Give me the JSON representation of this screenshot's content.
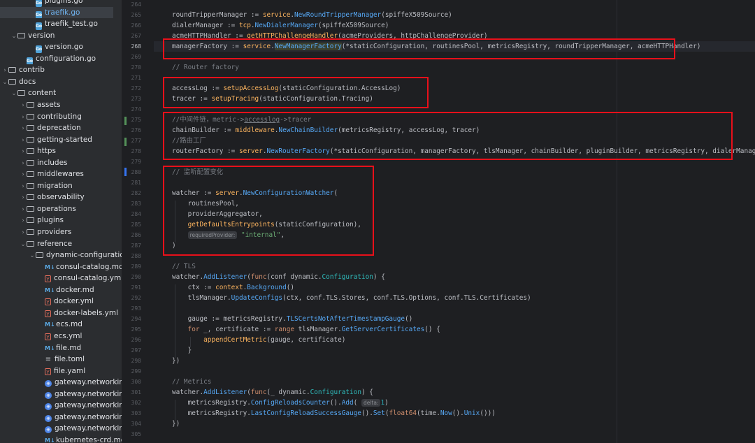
{
  "sidebar": {
    "items": [
      {
        "label": "plugins.go",
        "icon": "go-file-icon",
        "kind": "go",
        "depth": 3,
        "chev": "",
        "selected": false
      },
      {
        "label": "traefik.go",
        "icon": "go-file-icon",
        "kind": "go",
        "depth": 3,
        "chev": "",
        "selected": true
      },
      {
        "label": "traefik_test.go",
        "icon": "go-file-icon",
        "kind": "go",
        "depth": 3,
        "chev": "",
        "selected": false
      },
      {
        "label": "version",
        "icon": "folder-icon",
        "kind": "folder",
        "depth": 1,
        "chev": "⌄",
        "selected": false
      },
      {
        "label": "version.go",
        "icon": "go-file-icon",
        "kind": "go",
        "depth": 3,
        "chev": "",
        "selected": false
      },
      {
        "label": "configuration.go",
        "icon": "go-file-icon",
        "kind": "go",
        "depth": 2,
        "chev": "",
        "selected": false
      },
      {
        "label": "contrib",
        "icon": "folder-icon",
        "kind": "folder",
        "depth": 0,
        "chev": "›",
        "selected": false
      },
      {
        "label": "docs",
        "icon": "folder-icon",
        "kind": "folder",
        "depth": 0,
        "chev": "⌄",
        "selected": false
      },
      {
        "label": "content",
        "icon": "folder-icon",
        "kind": "folder",
        "depth": 1,
        "chev": "⌄",
        "selected": false
      },
      {
        "label": "assets",
        "icon": "folder-icon",
        "kind": "folder",
        "depth": 2,
        "chev": "›",
        "selected": false
      },
      {
        "label": "contributing",
        "icon": "folder-icon",
        "kind": "folder",
        "depth": 2,
        "chev": "›",
        "selected": false
      },
      {
        "label": "deprecation",
        "icon": "folder-icon",
        "kind": "folder",
        "depth": 2,
        "chev": "›",
        "selected": false
      },
      {
        "label": "getting-started",
        "icon": "folder-icon",
        "kind": "folder",
        "depth": 2,
        "chev": "›",
        "selected": false
      },
      {
        "label": "https",
        "icon": "folder-icon",
        "kind": "folder",
        "depth": 2,
        "chev": "›",
        "selected": false
      },
      {
        "label": "includes",
        "icon": "folder-icon",
        "kind": "folder",
        "depth": 2,
        "chev": "›",
        "selected": false
      },
      {
        "label": "middlewares",
        "icon": "folder-icon",
        "kind": "folder",
        "depth": 2,
        "chev": "›",
        "selected": false
      },
      {
        "label": "migration",
        "icon": "folder-icon",
        "kind": "folder",
        "depth": 2,
        "chev": "›",
        "selected": false
      },
      {
        "label": "observability",
        "icon": "folder-icon",
        "kind": "folder",
        "depth": 2,
        "chev": "›",
        "selected": false
      },
      {
        "label": "operations",
        "icon": "folder-icon",
        "kind": "folder",
        "depth": 2,
        "chev": "›",
        "selected": false
      },
      {
        "label": "plugins",
        "icon": "folder-icon",
        "kind": "folder",
        "depth": 2,
        "chev": "›",
        "selected": false
      },
      {
        "label": "providers",
        "icon": "folder-icon",
        "kind": "folder",
        "depth": 2,
        "chev": "›",
        "selected": false
      },
      {
        "label": "reference",
        "icon": "folder-icon",
        "kind": "folder",
        "depth": 2,
        "chev": "⌄",
        "selected": false
      },
      {
        "label": "dynamic-configuration",
        "icon": "folder-icon",
        "kind": "folder",
        "depth": 3,
        "chev": "⌄",
        "selected": false
      },
      {
        "label": "consul-catalog.md",
        "icon": "markdown-icon",
        "kind": "md",
        "depth": 4,
        "chev": "",
        "selected": false
      },
      {
        "label": "consul-catalog.yml",
        "icon": "yaml-icon",
        "kind": "yml",
        "depth": 4,
        "chev": "",
        "selected": false
      },
      {
        "label": "docker.md",
        "icon": "markdown-icon",
        "kind": "md",
        "depth": 4,
        "chev": "",
        "selected": false
      },
      {
        "label": "docker.yml",
        "icon": "yaml-icon",
        "kind": "yml",
        "depth": 4,
        "chev": "",
        "selected": false
      },
      {
        "label": "docker-labels.yml",
        "icon": "yaml-icon",
        "kind": "yml",
        "depth": 4,
        "chev": "",
        "selected": false
      },
      {
        "label": "ecs.md",
        "icon": "markdown-icon",
        "kind": "md",
        "depth": 4,
        "chev": "",
        "selected": false
      },
      {
        "label": "ecs.yml",
        "icon": "yaml-icon",
        "kind": "yml",
        "depth": 4,
        "chev": "",
        "selected": false
      },
      {
        "label": "file.md",
        "icon": "markdown-icon",
        "kind": "md",
        "depth": 4,
        "chev": "",
        "selected": false
      },
      {
        "label": "file.toml",
        "icon": "toml-icon",
        "kind": "toml",
        "depth": 4,
        "chev": "",
        "selected": false
      },
      {
        "label": "file.yaml",
        "icon": "yaml-icon",
        "kind": "yml",
        "depth": 4,
        "chev": "",
        "selected": false
      },
      {
        "label": "gateway.networking",
        "icon": "kubernetes-icon",
        "kind": "k8s",
        "depth": 4,
        "chev": "",
        "selected": false
      },
      {
        "label": "gateway.networking",
        "icon": "kubernetes-icon",
        "kind": "k8s",
        "depth": 4,
        "chev": "",
        "selected": false
      },
      {
        "label": "gateway.networking",
        "icon": "kubernetes-icon",
        "kind": "k8s",
        "depth": 4,
        "chev": "",
        "selected": false
      },
      {
        "label": "gateway.networking",
        "icon": "kubernetes-icon",
        "kind": "k8s",
        "depth": 4,
        "chev": "",
        "selected": false
      },
      {
        "label": "gateway.networking",
        "icon": "kubernetes-icon",
        "kind": "k8s",
        "depth": 4,
        "chev": "",
        "selected": false
      },
      {
        "label": "kubernetes-crd.md",
        "icon": "markdown-icon",
        "kind": "md",
        "depth": 4,
        "chev": "",
        "selected": false
      }
    ]
  },
  "editor": {
    "current_line": "268",
    "line_numbers": [
      "264",
      "265",
      "266",
      "267",
      "268",
      "269",
      "270",
      "271",
      "272",
      "273",
      "274",
      "275",
      "276",
      "277",
      "278",
      "279",
      "280",
      "281",
      "282",
      "283",
      "284",
      "285",
      "286",
      "287",
      "288",
      "289",
      "290",
      "291",
      "292",
      "293",
      "294",
      "295",
      "296",
      "297",
      "298",
      "299",
      "300",
      "301",
      "302",
      "303",
      "304",
      "305"
    ],
    "lines": {
      "l265": {
        "a": "roundTripperManager := ",
        "b": "service",
        "c": ".",
        "d": "NewRoundTripperManager",
        "e": "(spiffeX509Source)"
      },
      "l266": {
        "a": "dialerManager := ",
        "b": "tcp",
        "c": ".",
        "d": "NewDialerManager",
        "e": "(spiffeX509Source)"
      },
      "l267": {
        "a": "acmeHTTPHandler := ",
        "b": "getHTTPChallengeHandler",
        "c": "(acmeProviders, httpChallengeProvider)"
      },
      "l268": {
        "a": "managerFactory := ",
        "b": "service",
        "c": ".",
        "d": "NewManagerFactory",
        "e": "(*staticConfiguration, routinesPool, metricsRegistry, roundTripperManager, acmeHTTPHandler)"
      },
      "l270": {
        "a": "// Router factory"
      },
      "l272": {
        "a": "accessLog := ",
        "b": "setupAccessLog",
        "c": "(staticConfiguration.AccessLog)"
      },
      "l273": {
        "a": "tracer := ",
        "b": "setupTracing",
        "c": "(staticConfiguration.Tracing)"
      },
      "l275": {
        "a": "//中间件链，metric->",
        "b": "accesslog",
        "c": "->tracer"
      },
      "l276": {
        "a": "chainBuilder := ",
        "b": "middleware",
        "c": ".",
        "d": "NewChainBuilder",
        "e": "(metricsRegistry, accessLog, tracer)"
      },
      "l277": {
        "a": "//路由工厂"
      },
      "l278": {
        "a": "routerFactory := ",
        "b": "server",
        "c": ".",
        "d": "NewRouterFactory",
        "e": "(*staticConfiguration, managerFactory, tlsManager, chainBuilder, pluginBuilder, metricsRegistry, dialerManager)"
      },
      "l280": {
        "a": "// 监听配置变化"
      },
      "l282": {
        "a": "watcher := ",
        "b": "server",
        "c": ".",
        "d": "NewConfigurationWatcher",
        "e": "("
      },
      "l283": {
        "a": "    routinesPool,"
      },
      "l284": {
        "a": "    providerAggregator,"
      },
      "l285": {
        "a": "    ",
        "b": "getDefaultsEntrypoints",
        "c": "(staticConfiguration),"
      },
      "l286": {
        "hint": "requiredProvider:",
        "s": "\"internal\"",
        "e": ","
      },
      "l287": {
        "a": ")"
      },
      "l289": {
        "a": "// TLS"
      },
      "l290": {
        "a": "watcher.",
        "b": "AddListener",
        "c": "(",
        "k": "func",
        "d": "(conf ",
        "t": "dynamic",
        "e": ".",
        "ty": "Configuration",
        "g": ") {"
      },
      "l291": {
        "a": "    ctx := ",
        "b": "context",
        "c": ".",
        "d": "Background",
        "e": "()"
      },
      "l292": {
        "a": "    tlsManager.",
        "b": "UpdateConfigs",
        "c": "(ctx, conf.TLS.Stores, conf.TLS.Options, conf.TLS.Certificates)"
      },
      "l294": {
        "a": "    gauge := metricsRegistry.",
        "b": "TLSCertsNotAfterTimestampGauge",
        "c": "()"
      },
      "l295": {
        "a": "    ",
        "k": "for",
        "b": " _, certificate := ",
        "k2": "range",
        "c": " tlsManager.",
        "d": "GetServerCertificates",
        "e": "() {"
      },
      "l296": {
        "a": "        ",
        "b": "appendCertMetric",
        "c": "(gauge, certificate)"
      },
      "l297": {
        "a": "    }"
      },
      "l298": {
        "a": "})"
      },
      "l300": {
        "a": "// Metrics"
      },
      "l301": {
        "a": "watcher.",
        "b": "AddListener",
        "c": "(",
        "k": "func",
        "d": "(_ ",
        "t": "dynamic",
        "e": ".",
        "ty": "Configuration",
        "g": ") {"
      },
      "l302": {
        "a": "    metricsRegistry.",
        "b": "ConfigReloadsCounter",
        "c": "().",
        "d": "Add",
        "e": "( ",
        "hint": "delta:",
        "n": "1",
        "g": ")"
      },
      "l303": {
        "a": "    metricsRegistry.",
        "b": "LastConfigReloadSuccessGauge",
        "c": "().",
        "d": "Set",
        "e": "(",
        "f": "float64",
        "g": "(time.",
        "h": "Now",
        "i": "().",
        "j": "Unix",
        "k": "()))"
      },
      "l304": {
        "a": "})"
      }
    }
  },
  "colors": {
    "annotation_box": "#e8101a",
    "added_line_mark": "#549159",
    "modified_line_mark": "#3574f0"
  }
}
